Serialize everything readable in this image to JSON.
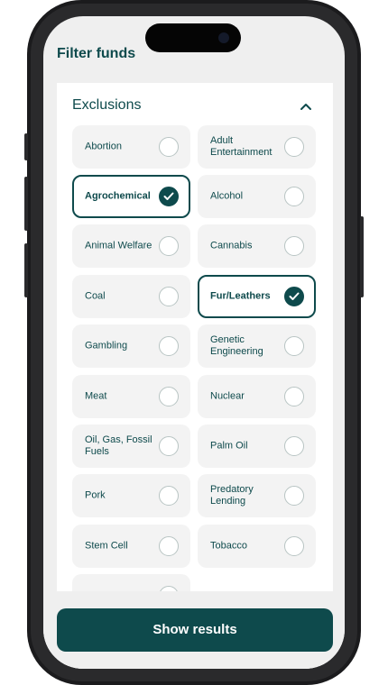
{
  "header": {
    "title": "Filter funds"
  },
  "exclusions": {
    "title": "Exclusions",
    "items": [
      {
        "label": "Abortion",
        "selected": false
      },
      {
        "label": "Adult Entertainment",
        "selected": false
      },
      {
        "label": "Agrochemical",
        "selected": true
      },
      {
        "label": "Alcohol",
        "selected": false
      },
      {
        "label": "Animal Welfare",
        "selected": false
      },
      {
        "label": "Cannabis",
        "selected": false
      },
      {
        "label": "Coal",
        "selected": false
      },
      {
        "label": "Fur/Leathers",
        "selected": true
      },
      {
        "label": "Gambling",
        "selected": false
      },
      {
        "label": "Genetic Engineering",
        "selected": false
      },
      {
        "label": "Meat",
        "selected": false
      },
      {
        "label": "Nuclear",
        "selected": false
      },
      {
        "label": "Oil, Gas, Fossil Fuels",
        "selected": false
      },
      {
        "label": "Palm Oil",
        "selected": false
      },
      {
        "label": "Pork",
        "selected": false
      },
      {
        "label": "Predatory Lending",
        "selected": false
      },
      {
        "label": "Stem Cell",
        "selected": false
      },
      {
        "label": "Tobacco",
        "selected": false
      }
    ]
  },
  "footer": {
    "button_label": "Show results"
  },
  "colors": {
    "accent": "#0e4a4c",
    "chip_bg": "#f3f3f3",
    "screen_bg": "#efefef"
  }
}
